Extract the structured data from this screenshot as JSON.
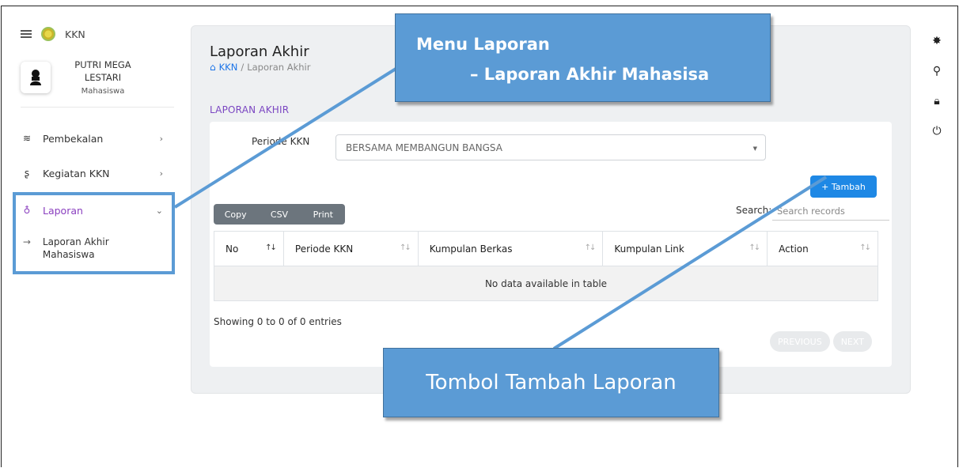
{
  "brand": {
    "name": "KKN"
  },
  "profile": {
    "name": "PUTRI MEGA LESTARI",
    "role": "Mahasiswa"
  },
  "sidebar": {
    "items": [
      {
        "label": "Pembekalan",
        "icon": "stack-icon",
        "chevron": "›"
      },
      {
        "label": "Kegiatan KKN",
        "icon": "hand-icon",
        "chevron": "›"
      },
      {
        "label": "Laporan",
        "icon": "pin-icon",
        "chevron": "⌄"
      }
    ],
    "sub_items": [
      {
        "label": "Laporan Akhir Mahasiswa"
      }
    ]
  },
  "page": {
    "title": "Laporan Akhir",
    "breadcrumb": {
      "root": "KKN",
      "separator": "/",
      "current": "Laporan Akhir"
    },
    "section_label": "LAPORAN AKHIR"
  },
  "form": {
    "period_label": "Periode KKN",
    "period_value": "BERSAMA MEMBANGUN BANGSA"
  },
  "toolbar": {
    "add_label": "+ Tambah",
    "export_buttons": [
      "Copy",
      "CSV",
      "Print"
    ],
    "search_label": "Search:",
    "search_placeholder": "Search records"
  },
  "table": {
    "columns": [
      "No",
      "Periode KKN",
      "Kumpulan Berkas",
      "Kumpulan Link",
      "Action"
    ],
    "empty_message": "No data available in table",
    "info": "Showing 0 to 0 of 0 entries",
    "pager": {
      "previous": "PREVIOUS",
      "next": "NEXT"
    }
  },
  "right_icons": [
    "gear-icon",
    "user-icon",
    "lock-icon",
    "power-icon"
  ],
  "callouts": {
    "menu": {
      "line1": "Menu Laporan",
      "line2": "–  Laporan Akhir Mahasisa"
    },
    "button": {
      "text": "Tombol Tambah Laporan"
    }
  },
  "colors": {
    "accent_purple": "#8a3fbf",
    "primary_blue": "#1e88e5",
    "callout_blue": "#5b9bd5"
  }
}
